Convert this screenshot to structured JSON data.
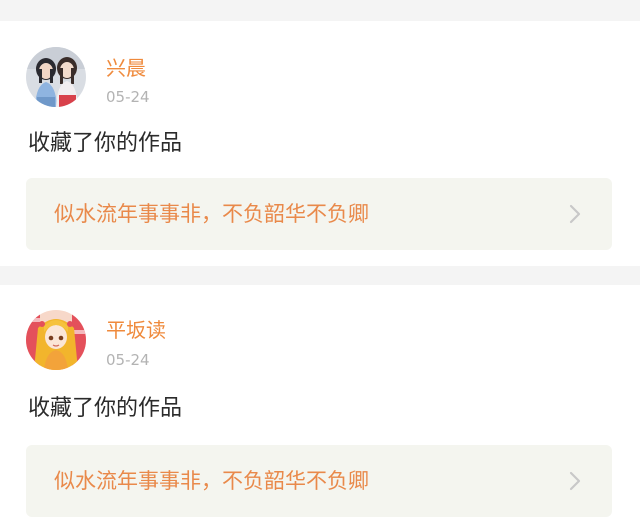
{
  "notifications": [
    {
      "username": "兴晨",
      "date": "05-24",
      "action": "收藏了你的作品",
      "work_title": "似水流年事事非，不负韶华不负卿",
      "avatar_icon": "avatar-two-girls-icon"
    },
    {
      "username": "平坂读",
      "date": "05-24",
      "action": "收藏了你的作品",
      "work_title": "似水流年事事非，不负韶华不负卿",
      "avatar_icon": "avatar-anime-girl-icon"
    }
  ],
  "colors": {
    "username": "#ef8a3c",
    "date": "#b3b3b3",
    "action_text": "#2b2b2b",
    "link_bg": "#f4f5ef",
    "link_text": "#e9894a",
    "chevron": "#c8c8c8",
    "page_bg": "#f4f4f4"
  }
}
